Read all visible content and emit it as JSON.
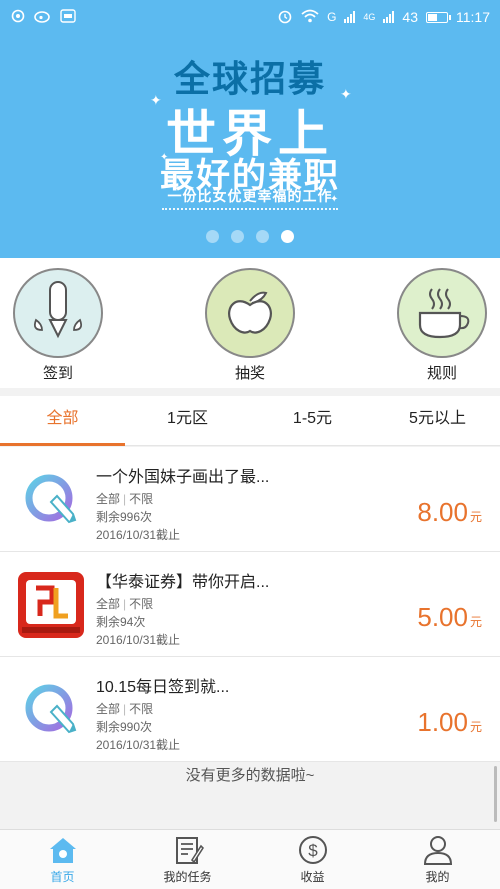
{
  "status_bar": {
    "battery": "43",
    "time": "11:17",
    "network": "4G",
    "carrier_mark": "G"
  },
  "banner": {
    "title_line1": "全球招募",
    "title_line2": "世界上",
    "title_line3": "最好的兼职",
    "subtitle": "一份比女优更幸福的工作",
    "page_count": 4,
    "active_page": 4
  },
  "quick_actions": [
    {
      "label": "签到",
      "icon": "sign-in-icon"
    },
    {
      "label": "抽奖",
      "icon": "lottery-apple-icon"
    },
    {
      "label": "规则",
      "icon": "rules-cup-icon"
    }
  ],
  "tabs": [
    {
      "label": "全部",
      "active": true
    },
    {
      "label": "1元区",
      "active": false
    },
    {
      "label": "1-5元",
      "active": false
    },
    {
      "label": "5元以上",
      "active": false
    }
  ],
  "tasks": [
    {
      "title": "一个外国妹子画出了最...",
      "category": "全部",
      "limit": "不限",
      "remaining": "剩余996次",
      "deadline": "2016/10/31截止",
      "price": "8.00",
      "unit": "元",
      "icon": "q-pen-icon"
    },
    {
      "title": "【华泰证券】带你开启...",
      "category": "全部",
      "limit": "不限",
      "remaining": "剩余94次",
      "deadline": "2016/10/31截止",
      "price": "5.00",
      "unit": "元",
      "icon": "huatai-logo-icon"
    },
    {
      "title": "10.15每日签到就...",
      "category": "全部",
      "limit": "不限",
      "remaining": "剩余990次",
      "deadline": "2016/10/31截止",
      "price": "1.00",
      "unit": "元",
      "icon": "q-pen-icon"
    }
  ],
  "no_more_text": "没有更多的数据啦~",
  "bottom_nav": [
    {
      "label": "首页",
      "icon": "home-icon",
      "active": true
    },
    {
      "label": "我的任务",
      "icon": "task-icon",
      "active": false
    },
    {
      "label": "收益",
      "icon": "dollar-icon",
      "active": false
    },
    {
      "label": "我的",
      "icon": "user-icon",
      "active": false
    }
  ],
  "colors": {
    "primary": "#5cbaf0",
    "accent": "#e8732d",
    "nav_active": "#39a8e8"
  }
}
